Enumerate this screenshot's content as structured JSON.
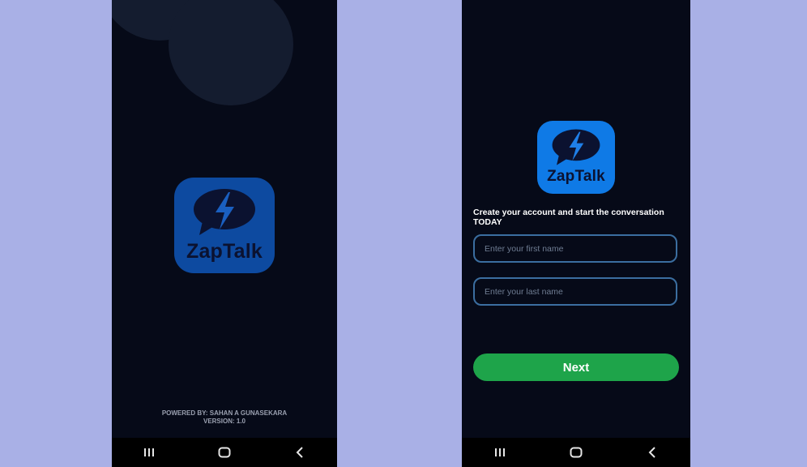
{
  "splash": {
    "app_name": "ZapTalk",
    "powered_by": "POWERED BY: SAHAN A GUNASEKARA",
    "version": "VERSION: 1.0"
  },
  "signup": {
    "app_name": "ZapTalk",
    "heading": "Create your account and start the conversation TODAY",
    "first_name": {
      "value": "",
      "placeholder": "Enter your first name"
    },
    "last_name": {
      "value": "",
      "placeholder": "Enter your last name"
    },
    "next_label": "Next"
  },
  "navbar": {
    "icons": [
      "recent-apps-icon",
      "home-icon",
      "back-icon"
    ]
  },
  "colors": {
    "page_background": "#a9b0e6",
    "screen_background": "#060a18",
    "logo_splash": "#0d4aa0",
    "logo_signup": "#0f7ae6",
    "input_border": "#3b6ea0",
    "next_button": "#1ea44a"
  }
}
